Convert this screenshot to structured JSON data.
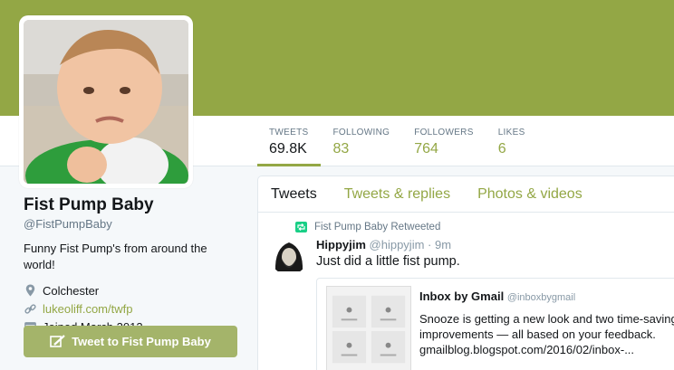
{
  "profile": {
    "name": "Fist Pump Baby",
    "handle": "@FistPumpBaby",
    "bio": "Funny Fist Pump's from around the world!",
    "location": "Colchester",
    "website": "lukeoliff.com/twfp",
    "joined": "Joined March 2012",
    "tweet_button": "Tweet to Fist Pump Baby"
  },
  "stats": [
    {
      "label": "TWEETS",
      "value": "69.8K"
    },
    {
      "label": "FOLLOWING",
      "value": "83"
    },
    {
      "label": "FOLLOWERS",
      "value": "764"
    },
    {
      "label": "LIKES",
      "value": "6"
    }
  ],
  "tabs": [
    {
      "label": "Tweets"
    },
    {
      "label": "Tweets & replies"
    },
    {
      "label": "Photos & videos"
    }
  ],
  "tweet": {
    "retweet_label": "Fist Pump Baby Retweeted",
    "author": "Hippyjim",
    "handle": "@hippyjim",
    "separator": "·",
    "time": "9m",
    "text": "Just did a little fist pump.",
    "card": {
      "title": "Inbox by Gmail",
      "handle": "@inboxbygmail",
      "description": "Snooze is getting a new look and two time-saving improvements — all based on your feedback.",
      "url": "gmailblog.blogspot.com/2016/02/inbox-..."
    }
  },
  "colors": {
    "accent": "#93a745",
    "button": "#a4b46a",
    "retweet": "#19cf86"
  }
}
